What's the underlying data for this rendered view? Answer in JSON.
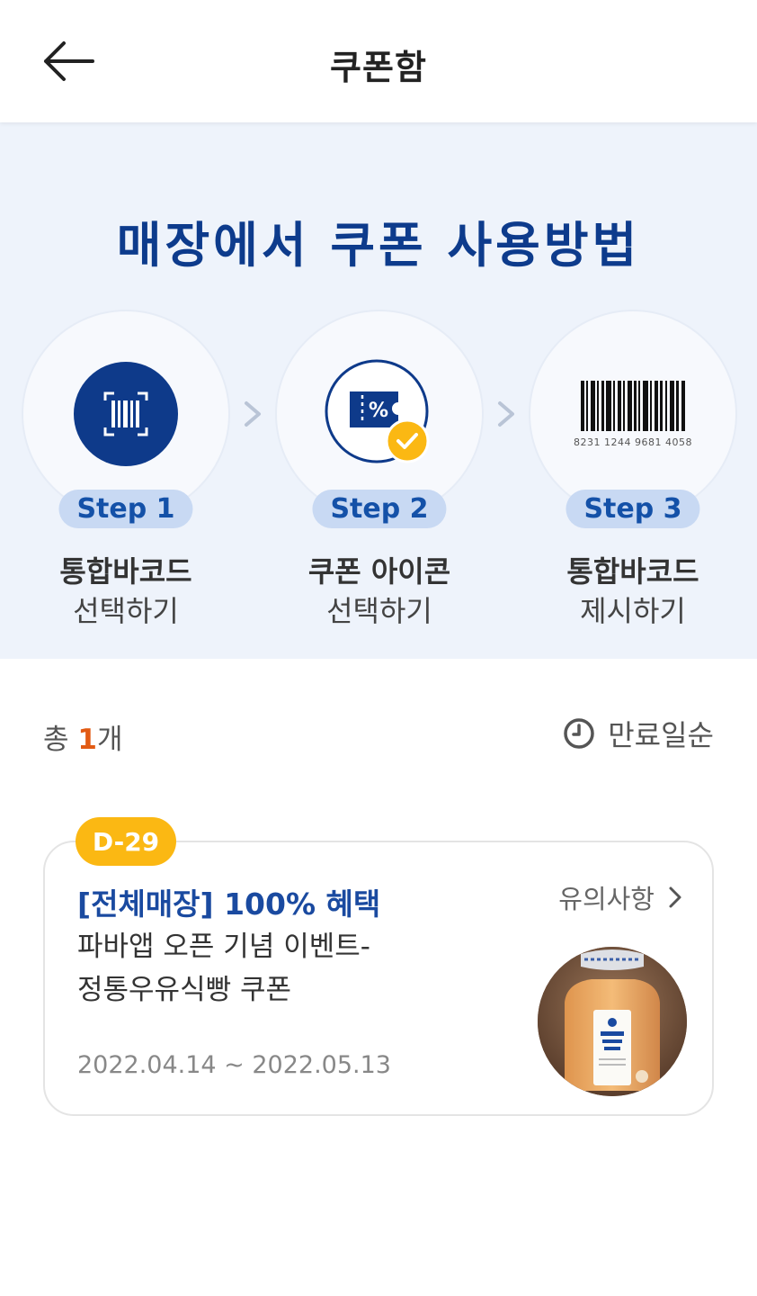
{
  "header": {
    "title": "쿠폰함"
  },
  "guide": {
    "title": "매장에서 쿠폰 사용방법",
    "steps": [
      {
        "badge": "Step 1",
        "title": "통합바코드",
        "sub": "선택하기",
        "icon": "barcode-scan-icon"
      },
      {
        "badge": "Step 2",
        "title": "쿠폰 아이콘",
        "sub": "선택하기",
        "icon": "coupon-check-icon"
      },
      {
        "badge": "Step 3",
        "title": "통합바코드",
        "sub": "제시하기",
        "icon": "barcode-icon",
        "barcode_number": "8231 1244 9681 4058"
      }
    ]
  },
  "list": {
    "count_prefix": "총 ",
    "count": "1",
    "count_suffix": "개",
    "sort_label": "만료일순",
    "sort_icon": "clock-icon"
  },
  "coupon": {
    "dday": "D-29",
    "title": "[전체매장] 100% 혜택",
    "desc_line1": "파바앱 오픈 기념 이벤트-",
    "desc_line2": "정통우유식빵 쿠폰",
    "period": "2022.04.14 ~ 2022.05.13",
    "notice_label": "유의사항",
    "product_label": "정통우유식빵"
  },
  "colors": {
    "brand_navy": "#0d3b8c",
    "guide_bg": "#eef3fb",
    "badge_bg": "#c8d9f3",
    "dday_yellow": "#fbb813",
    "count_orange": "#e25a13"
  }
}
